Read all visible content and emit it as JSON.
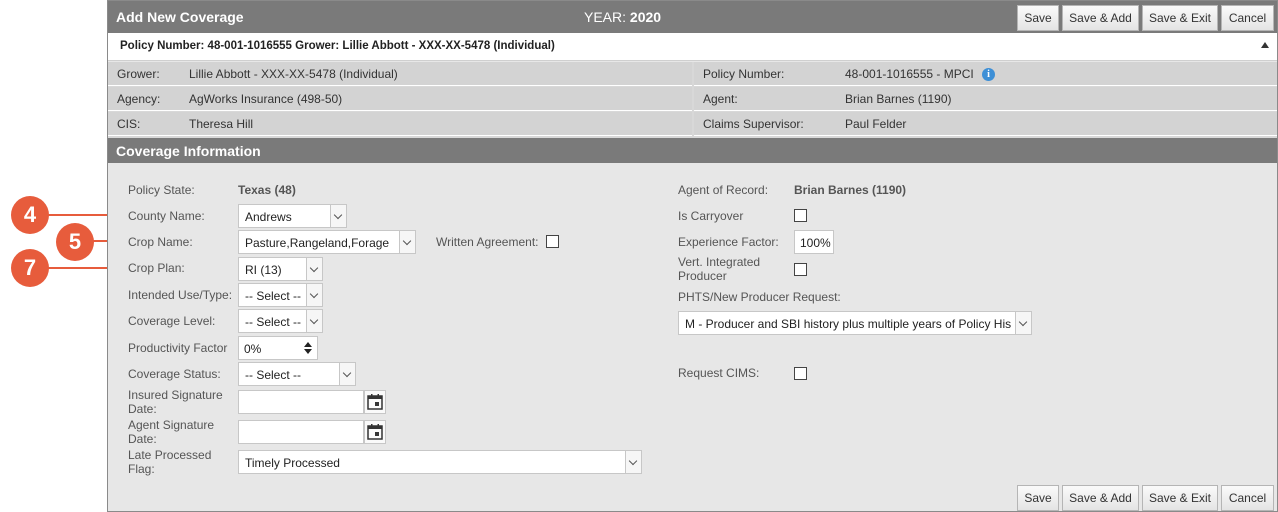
{
  "header": {
    "title": "Add New Coverage",
    "year_label": "YEAR:",
    "year_value": "2020"
  },
  "buttons": {
    "save": "Save",
    "save_add": "Save & Add",
    "save_exit": "Save & Exit",
    "cancel": "Cancel"
  },
  "policy_bar": {
    "text": "Policy Number: 48-001-1016555 Grower: Lillie Abbott - XXX-XX-5478 (Individual)"
  },
  "info": {
    "grower_label": "Grower:",
    "grower_value": "Lillie Abbott - XXX-XX-5478 (Individual)",
    "agency_label": "Agency:",
    "agency_value": "AgWorks Insurance (498-50)",
    "cis_label": "CIS:",
    "cis_value": "Theresa Hill",
    "policy_number_label": "Policy Number:",
    "policy_number_value": "48-001-1016555 - MPCI",
    "agent_label": "Agent:",
    "agent_value": "Brian Barnes (1190)",
    "claims_label": "Claims Supervisor:",
    "claims_value": "Paul Felder",
    "info_icon": "i"
  },
  "coverage": {
    "section_title": "Coverage Information",
    "policy_state_label": "Policy State:",
    "policy_state_value": "Texas (48)",
    "county_label": "County Name:",
    "county_value": "Andrews",
    "crop_name_label": "Crop Name:",
    "crop_name_value": "Pasture,Rangeland,Forage",
    "written_agreement_label": "Written Agreement:",
    "crop_plan_label": "Crop Plan:",
    "crop_plan_value": "RI (13)",
    "intended_use_label": "Intended Use/Type:",
    "intended_use_value": "-- Select --",
    "coverage_level_label": "Coverage Level:",
    "coverage_level_value": "-- Select --",
    "productivity_label": "Productivity Factor",
    "productivity_value": "0%",
    "coverage_status_label": "Coverage Status:",
    "coverage_status_value": "-- Select --",
    "insured_sig_label_1": "Insured Signature",
    "insured_sig_label_2": "Date:",
    "agent_sig_label_1": "Agent Signature",
    "agent_sig_label_2": "Date:",
    "late_processed_label_1": "Late Processed",
    "late_processed_label_2": "Flag:",
    "late_processed_value": "Timely Processed",
    "agent_of_record_label": "Agent of Record:",
    "agent_of_record_value": "Brian Barnes (1190)",
    "carryover_label": "Is Carryover",
    "experience_label": "Experience Factor:",
    "experience_value": "100%",
    "vert_label_1": "Vert. Integrated",
    "vert_label_2": "Producer",
    "phts_label": "PHTS/New Producer Request:",
    "phts_value": "M - Producer and SBI history plus multiple years of Policy His",
    "cims_label": "Request CIMS:"
  },
  "markers": {
    "county": "4",
    "crop_name": "5",
    "crop_plan": "7"
  },
  "colors": {
    "header_bg": "#7a7a7a",
    "marker": "#e75c3c",
    "info_icon": "#3d8fd6"
  }
}
